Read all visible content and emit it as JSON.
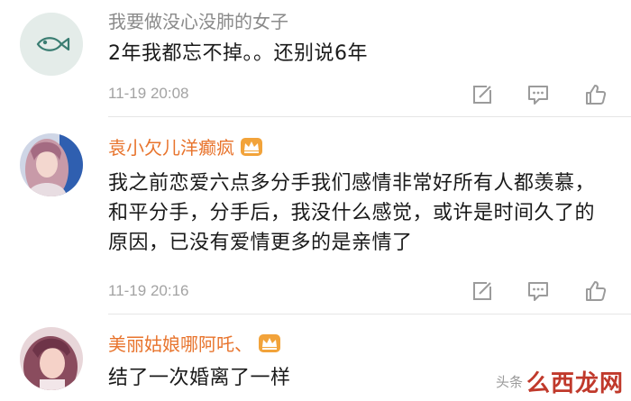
{
  "comments": [
    {
      "username": "我要做没心没肺的女子",
      "text": "2年我都忘不掉。。还别说6年",
      "time": "11-19 20:08"
    },
    {
      "username": "袁小欠儿洋癫疯",
      "text": "我之前恋爱六点多分手我们感情非常好所有人都羡慕，和平分手，分手后，我没什么感觉，或许是时间久了的原因，已没有爱情更多的是亲情了",
      "time": "11-19 20:16"
    },
    {
      "username": "美丽姑娘哪阿吒、",
      "text": "结了一次婚离了一样"
    }
  ],
  "watermark": {
    "prefix": "头条",
    "brand": "么西龙网"
  },
  "colors": {
    "username_plain": "#8a8a8a",
    "username_vip": "#e8742d",
    "text": "#1a1a1a",
    "timestamp": "#a3a3a3",
    "icon": "#9b9b9b",
    "watermark_brand": "#c0392b"
  },
  "icons": {
    "repost": "share-square-icon",
    "reply": "comment-bubble-icon",
    "like": "thumbs-up-icon",
    "vip": "crown-badge-icon",
    "default_avatar": "fish-icon"
  }
}
